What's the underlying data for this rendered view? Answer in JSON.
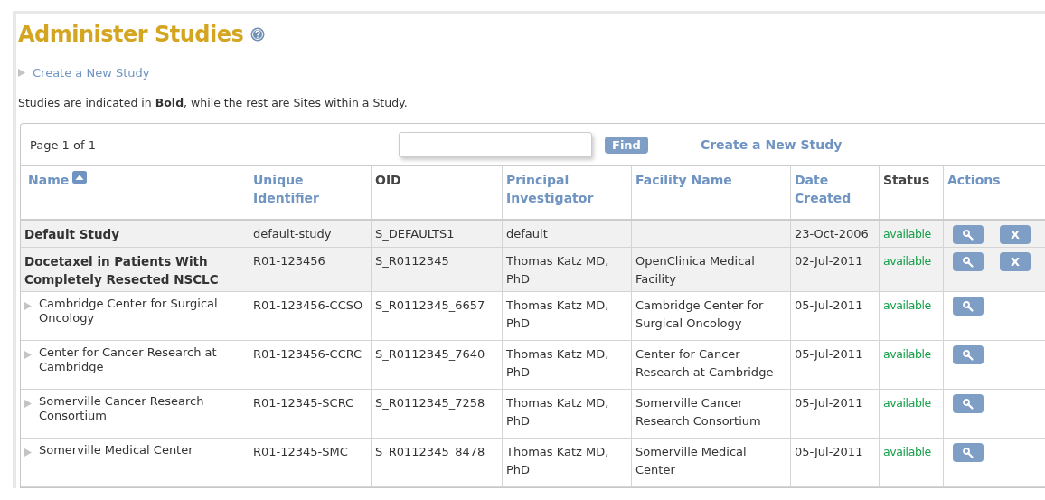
{
  "page": {
    "title": "Administer Studies",
    "create_link": "Create a New Study",
    "note": "Studies are indicated in **Bold**, while the rest are Sites within a Study."
  },
  "toolbar": {
    "paging": "Page 1 of 1",
    "find_button": "Find",
    "create_link": "Create a New Study"
  },
  "table": {
    "columns": [
      {
        "label": "Name",
        "sortable": true,
        "sorted": true
      },
      {
        "label": "Unique Identifier",
        "sortable": true,
        "sorted": false
      },
      {
        "label": "OID",
        "sortable": false,
        "sorted": false
      },
      {
        "label": "Principal Investigator",
        "sortable": true,
        "sorted": false
      },
      {
        "label": "Facility Name",
        "sortable": true,
        "sorted": false
      },
      {
        "label": "Date Created",
        "sortable": true,
        "sorted": false
      },
      {
        "label": "Status",
        "sortable": false,
        "sorted": false
      },
      {
        "label": "Actions",
        "sortable": true,
        "sorted": false
      }
    ],
    "rows": [
      {
        "kind": "study",
        "name": "Default Study",
        "uid": "default-study",
        "oid": "S_DEFAULTS1",
        "pi": "default",
        "facility": "",
        "date": "23-Oct-2006",
        "status": "available",
        "actions": [
          {
            "kind": "view"
          },
          {
            "kind": "remove",
            "label": "X"
          }
        ]
      },
      {
        "kind": "study",
        "name": "Docetaxel in Patients With Completely Resected NSCLC",
        "uid": "R01-123456",
        "oid": "S_R0112345",
        "pi": "Thomas Katz MD, PhD",
        "facility": "OpenClinica Medical Facility",
        "date": "02-Jul-2011",
        "status": "available",
        "actions": [
          {
            "kind": "view"
          },
          {
            "kind": "remove",
            "label": "X"
          }
        ]
      },
      {
        "kind": "site",
        "name": "Cambridge Center for Surgical Oncology",
        "uid": "R01-123456-CCSO",
        "oid": "S_R0112345_6657",
        "pi": "Thomas Katz MD, PhD",
        "facility": "Cambridge Center for Surgical Oncology",
        "date": "05-Jul-2011",
        "status": "available",
        "actions": [
          {
            "kind": "view"
          }
        ]
      },
      {
        "kind": "site",
        "name": "Center for Cancer Research at Cambridge",
        "uid": "R01-123456-CCRC",
        "oid": "S_R0112345_7640",
        "pi": "Thomas Katz MD, PhD",
        "facility": "Center for Cancer Research at Cambridge",
        "date": "05-Jul-2011",
        "status": "available",
        "actions": [
          {
            "kind": "view"
          }
        ]
      },
      {
        "kind": "site",
        "name": "Somerville Cancer Research Consortium",
        "uid": "R01-12345-SCRC",
        "oid": "S_R0112345_7258",
        "pi": "Thomas Katz MD, PhD",
        "facility": "Somerville Cancer Research Consortium",
        "date": "05-Jul-2011",
        "status": "available",
        "actions": [
          {
            "kind": "view"
          }
        ]
      },
      {
        "kind": "site",
        "name": "Somerville Medical Center",
        "uid": "R01-12345-SMC",
        "oid": "S_R0112345_8478",
        "pi": "Thomas Katz MD, PhD",
        "facility": "Somerville Medical Center",
        "date": "05-Jul-2011",
        "status": "available",
        "actions": [
          {
            "kind": "view"
          }
        ]
      }
    ]
  }
}
